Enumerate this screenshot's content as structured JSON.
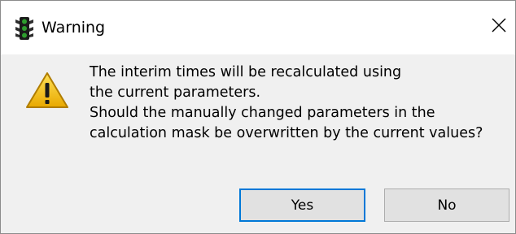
{
  "window": {
    "title": "Warning",
    "app_icon": "traffic-light-icon",
    "close_glyph": "×"
  },
  "dialog": {
    "icon": "warning-icon",
    "message_lines": [
      "The interim times will be recalculated using",
      "the current parameters.",
      "Should the manually changed parameters in the",
      "calculation mask be overwritten by the current values?"
    ]
  },
  "buttons": {
    "yes_label": "Yes",
    "no_label": "No"
  },
  "colors": {
    "focus_border": "#0078d7",
    "button_bg": "#e1e1e1",
    "content_bg": "#f0f0f0",
    "warning_yellow": "#f5c400"
  }
}
